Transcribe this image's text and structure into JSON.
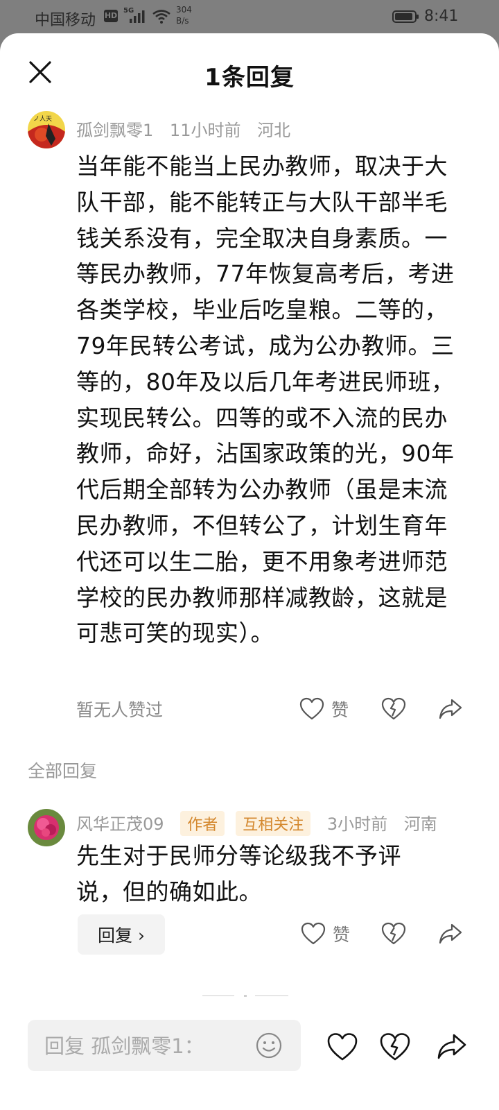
{
  "status_bar": {
    "carrier": "中国移动",
    "hd": "HD",
    "network": "5G",
    "speed_value": "304",
    "speed_unit": "B/s",
    "time": "8:41"
  },
  "header": {
    "title": "1条回复"
  },
  "main_comment": {
    "username": "孤剑飘零1",
    "time": "11小时前",
    "location": "河北",
    "body": "当年能不能当上民办教师，取决于大队干部，能不能转正与大队干部半毛钱关系没有，完全取决自身素质。一等民办教师，77年恢复高考后，考进各类学校，毕业后吃皇粮。二等的，79年民转公考试，成为公办教师。三等的，80年及以后几年考进民师班，实现民转公。四等的或不入流的民办教师，命好，沾国家政策的光，90年代后期全部转为公办教师（虽是末流民办教师，不但转公了，计划生育年代还可以生二胎，更不用象考进师范学校的民办教师那样减教龄，这就是可悲可笑的现实）。",
    "likes_text": "暂无人赞过",
    "like_label": "赞"
  },
  "replies_section": {
    "label": "全部回复"
  },
  "replies": [
    {
      "username": "风华正茂09",
      "tags": [
        "作者",
        "互相关注"
      ],
      "time": "3小时前",
      "location": "河南",
      "body": "先生对于民师分等论级我不予评说，但的确如此。",
      "reply_button": "回复 ›",
      "like_label": "赞"
    }
  ],
  "input": {
    "placeholder": "回复 孤剑飘零1："
  },
  "colors": {
    "tag_bg": "#fdf1de",
    "tag_text": "#d4882e",
    "meta_text": "#999999"
  }
}
